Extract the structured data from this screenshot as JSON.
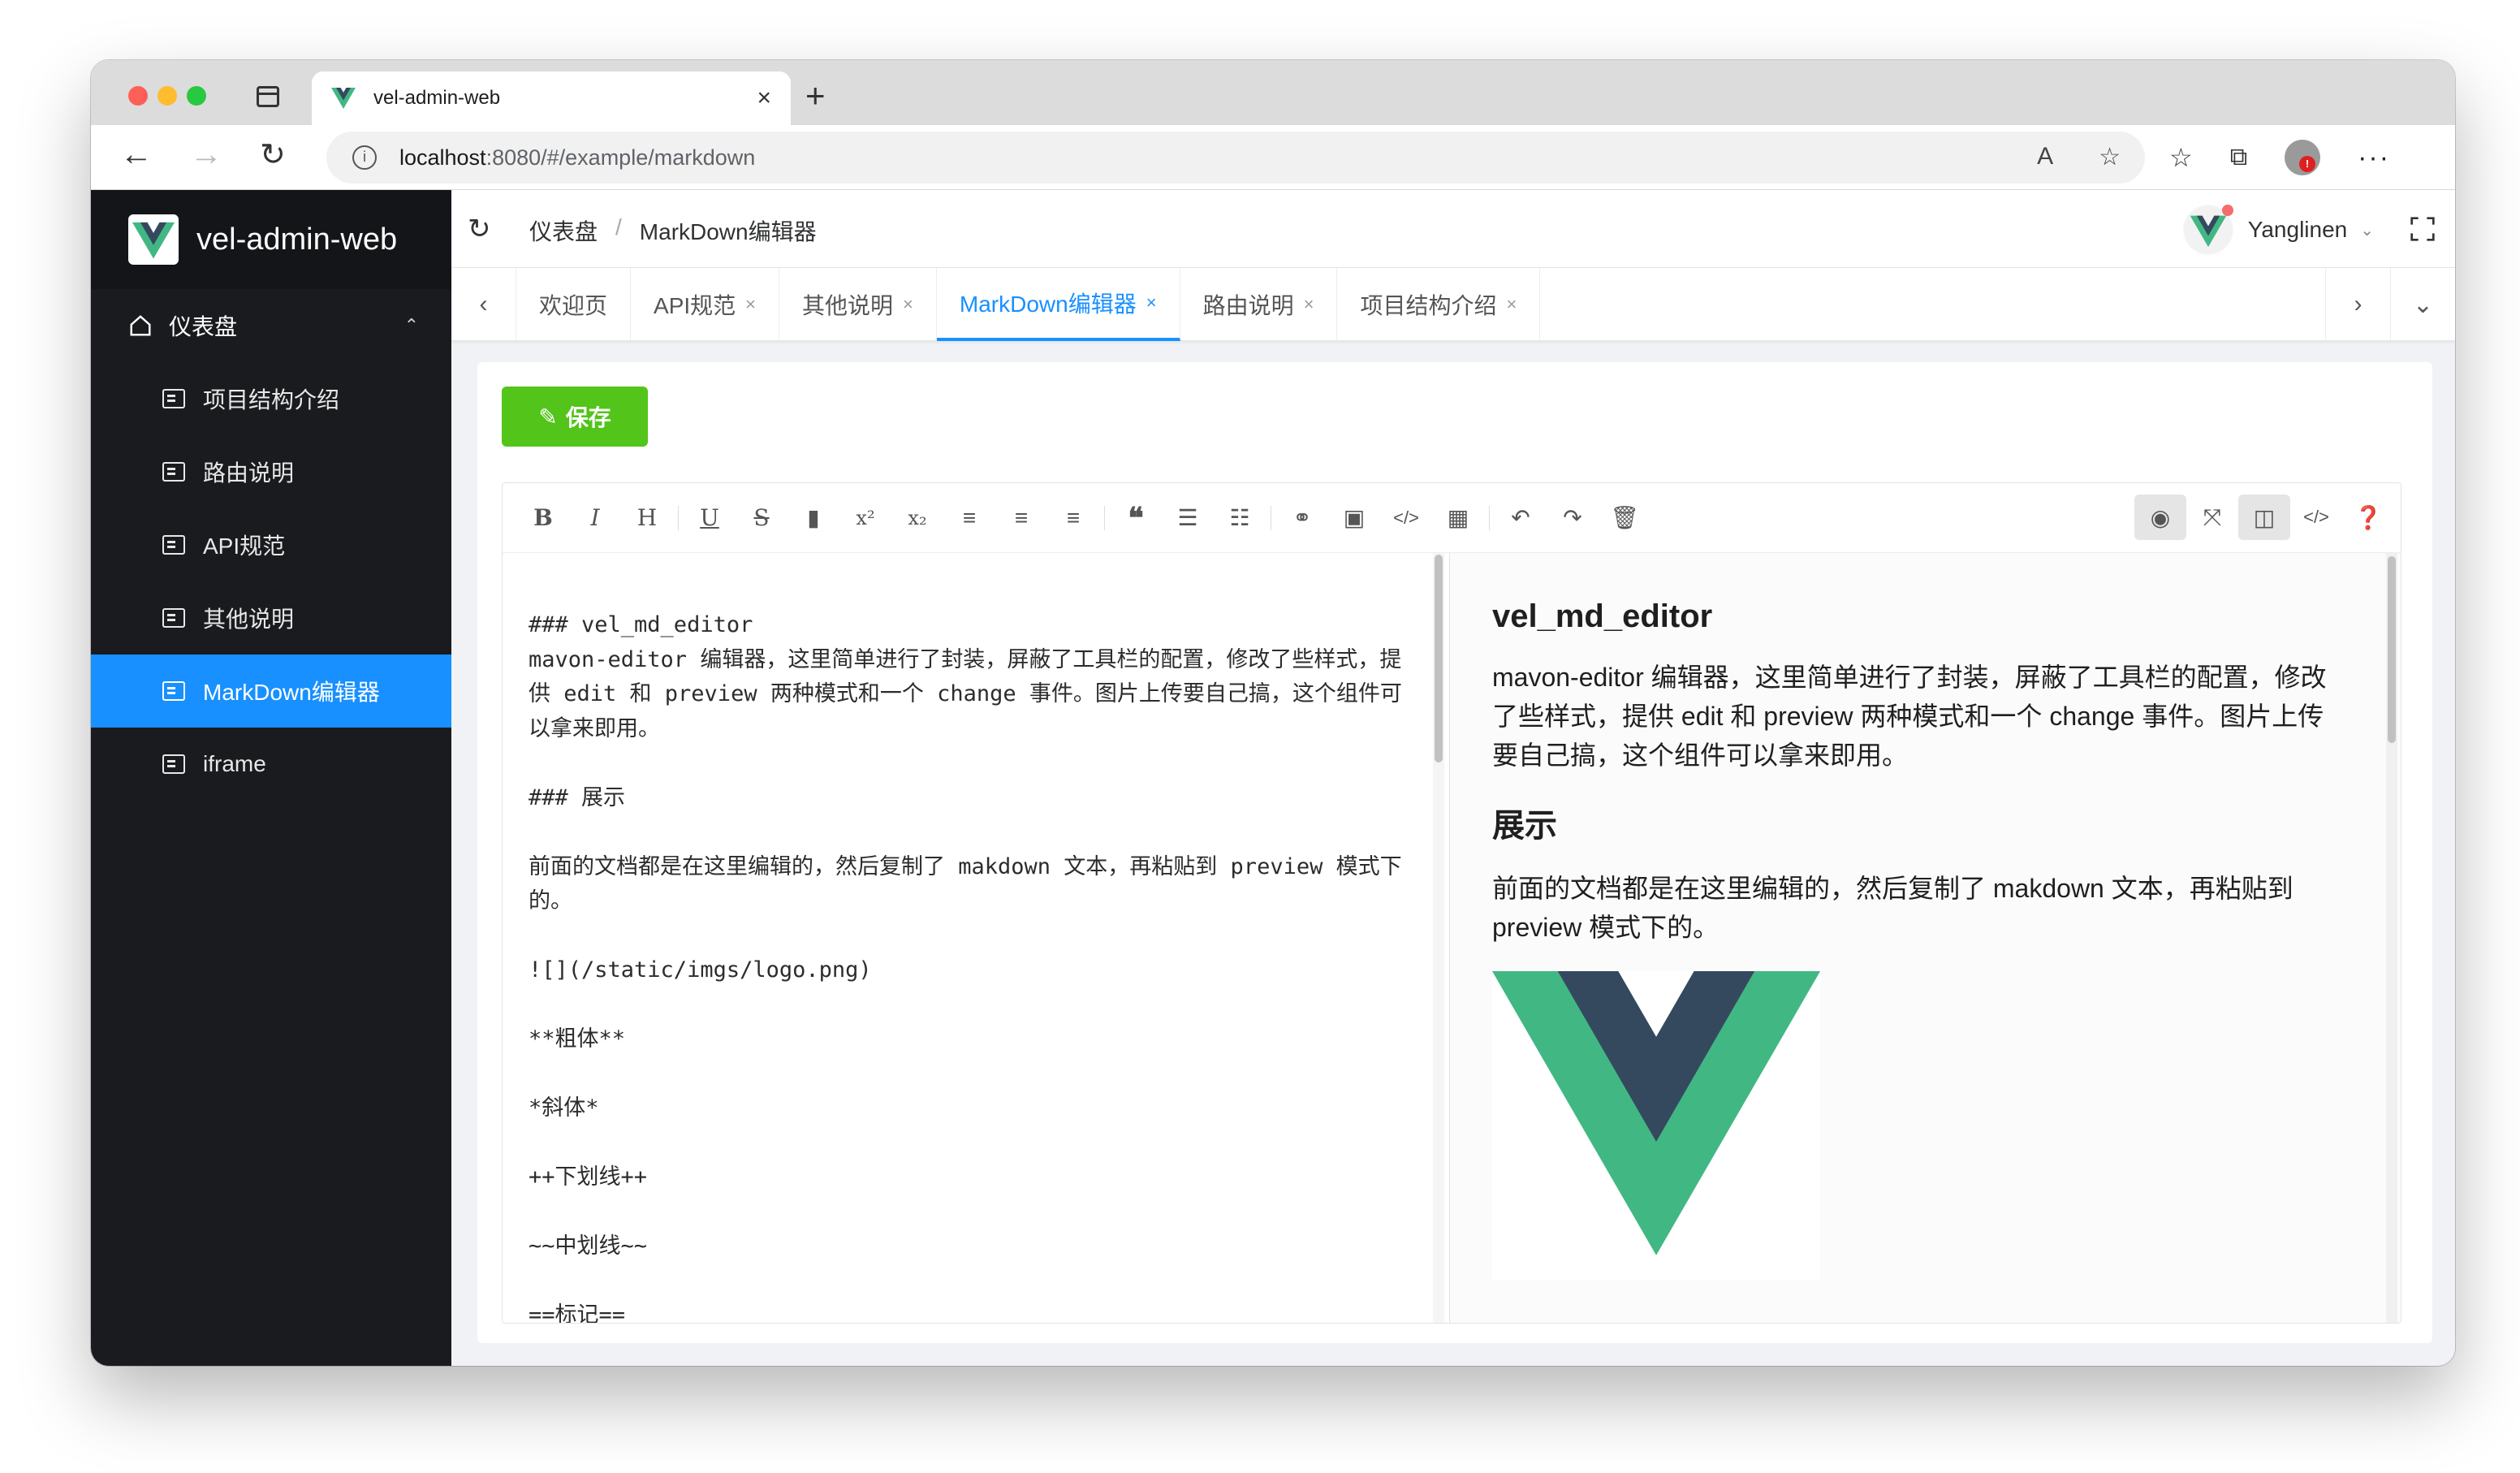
{
  "browser": {
    "tab_title": "vel-admin-web",
    "url_host": "localhost",
    "url_rest": ":8080/#/example/markdown"
  },
  "colors": {
    "sidebar_bg": "#1a1b1e",
    "active_menu": "#1890ff",
    "save_button": "#52c41a",
    "vue_green": "#41b883",
    "vue_dark": "#35495e"
  },
  "sidebar": {
    "app_name": "vel-admin-web",
    "parent_label": "仪表盘",
    "items": [
      {
        "label": "项目结构介绍"
      },
      {
        "label": "路由说明"
      },
      {
        "label": "API规范"
      },
      {
        "label": "其他说明"
      },
      {
        "label": "MarkDown编辑器"
      },
      {
        "label": "iframe"
      }
    ]
  },
  "navbar": {
    "breadcrumb": [
      "仪表盘",
      "/",
      "MarkDown编辑器"
    ],
    "username": "Yanglinen"
  },
  "tags": [
    {
      "label": "欢迎页"
    },
    {
      "label": "API规范"
    },
    {
      "label": "其他说明"
    },
    {
      "label": "MarkDown编辑器"
    },
    {
      "label": "路由说明"
    },
    {
      "label": "项目结构介绍"
    }
  ],
  "page": {
    "save_label": "保存"
  },
  "editor": {
    "source_text": "### vel_md_editor\nmavon-editor 编辑器，这里简单进行了封装，屏蔽了工具栏的配置，修改了些样式，提供 edit 和 preview 两种模式和一个 change 事件。图片上传要自己搞，这个组件可以拿来即用。\n\n### 展示\n\n前面的文档都是在这里编辑的，然后复制了 makdown 文本，再粘贴到 preview 模式下的。\n\n![](/static/imgs/logo.png)\n\n**粗体**\n\n*斜体*\n\n++下划线++\n\n~~中划线~~\n\n==标记==",
    "preview": {
      "h1": "vel_md_editor",
      "p1": "mavon-editor 编辑器，这里简单进行了封装，屏蔽了工具栏的配置，修改了些样式，提供 edit 和 preview 两种模式和一个 change 事件。图片上传要自己搞，这个组件可以拿来即用。",
      "h2": "展示",
      "p2": "前面的文档都是在这里编辑的，然后复制了 makdown 文本，再粘贴到 preview 模式下的。"
    }
  }
}
